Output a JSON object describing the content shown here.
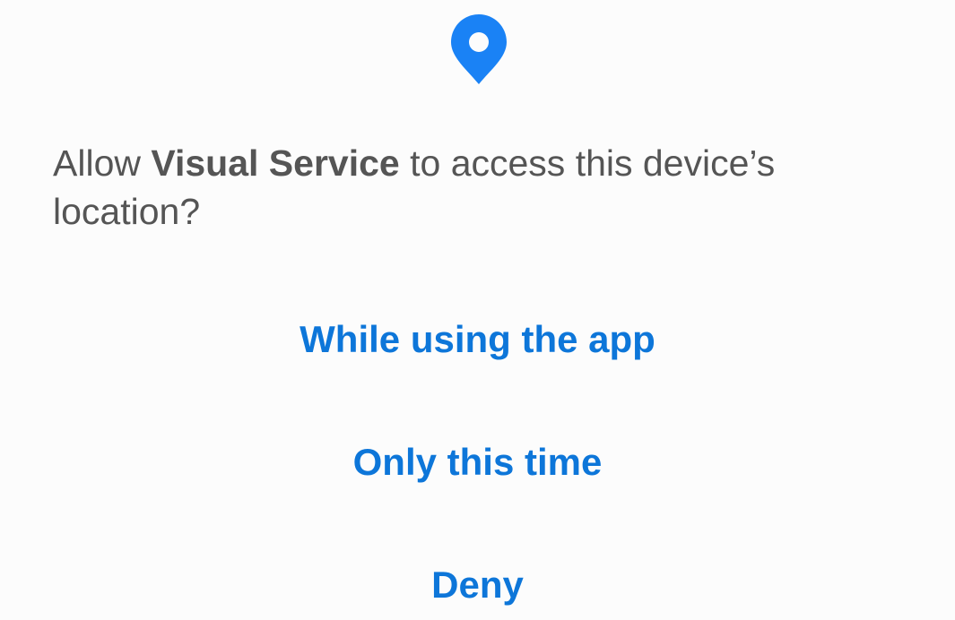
{
  "dialog": {
    "icon": "location-pin-icon",
    "message_prefix": "Allow ",
    "app_name": "Visual Service",
    "message_suffix": " to access this device’s location?",
    "buttons": {
      "while_using": "While using the app",
      "only_this_time": "Only this time",
      "deny": "Deny"
    }
  },
  "colors": {
    "accent": "#0d76d9",
    "pin": "#1a82f5",
    "text": "#555555",
    "background": "#fcfcfc"
  }
}
